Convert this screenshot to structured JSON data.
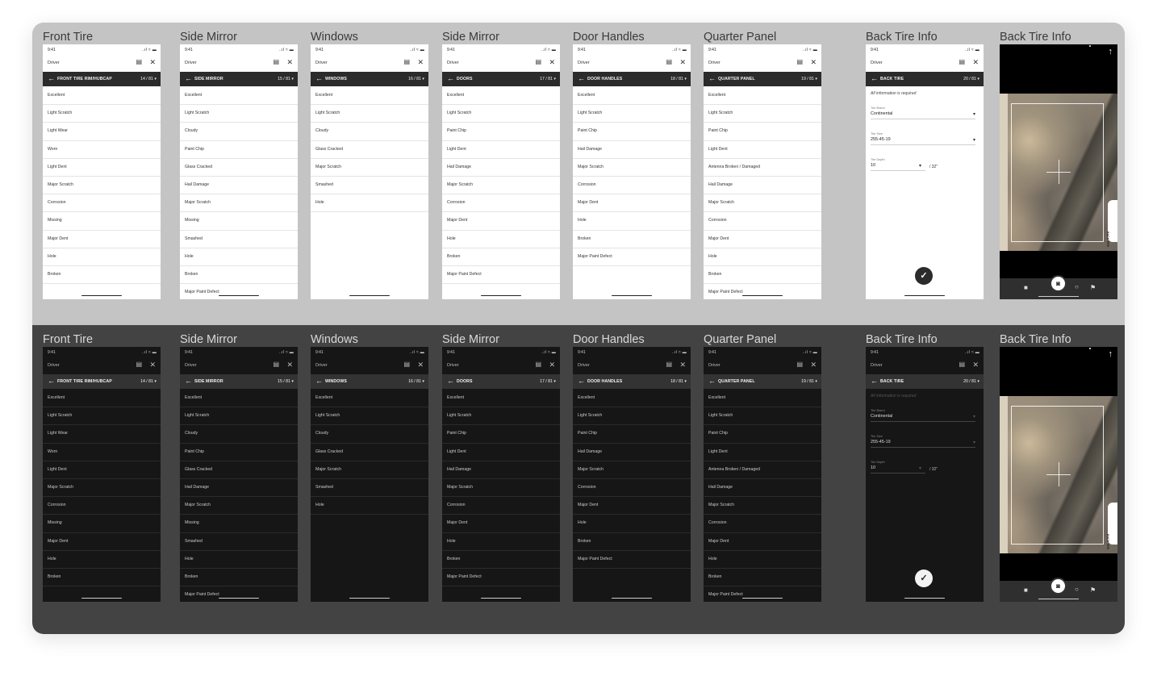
{
  "status": {
    "time": "9:41",
    "signal": "..ıl ≈ ▬"
  },
  "driver_label": "Driver",
  "icons": {
    "doc": "document-icon",
    "close": "close-icon",
    "back": "arrow-left-icon",
    "up": "arrow-up-icon",
    "check": "check-icon"
  },
  "frames": [
    {
      "title": "Front Tire",
      "nav": "FRONT TIRE RIM/HUBCAP",
      "count": "14 / 81",
      "options": [
        "Excellent",
        "Light Scratch",
        "Light Wear",
        "Worn",
        "Light Dent",
        "Major Scratch",
        "Corrosion",
        "Missing",
        "Major Dent",
        "Hole",
        "Broken"
      ]
    },
    {
      "title": "Side Mirror",
      "nav": "SIDE MIRROR",
      "count": "15 / 81",
      "options": [
        "Excellent",
        "Light Scratch",
        "Cloudy",
        "Paint Chip",
        "Glass Cracked",
        "Hail Damage",
        "Major Scratch",
        "Missing",
        "Smashed",
        "Hole",
        "Broken",
        "Major Paint Defect"
      ]
    },
    {
      "title": "Windows",
      "nav": "WINDOWS",
      "count": "16 / 81",
      "options": [
        "Excellent",
        "Light Scratch",
        "Cloudy",
        "Glass Cracked",
        "Major Scratch",
        "Smashed",
        "Hole"
      ]
    },
    {
      "title": "Side Mirror",
      "nav": "DOORS",
      "count": "17 / 81",
      "options": [
        "Excellent",
        "Light Scratch",
        "Paint Chip",
        "Light Dent",
        "Hail Damage",
        "Major Scratch",
        "Corrosion",
        "Major Dent",
        "Hole",
        "Broken",
        "Major Paint Defect"
      ]
    },
    {
      "title": "Door Handles",
      "nav": "DOOR HANDLES",
      "count": "18 / 81",
      "options": [
        "Excellent",
        "Light Scratch",
        "Paint Chip",
        "Hail Damage",
        "Major Scratch",
        "Corrosion",
        "Major Dent",
        "Hole",
        "Broken",
        "Major Paint Defect"
      ]
    },
    {
      "title": "Quarter Panel",
      "nav": "QUARTER PANEL",
      "count": "19 / 81",
      "options": [
        "Excellent",
        "Light Scratch",
        "Paint Chip",
        "Light Dent",
        "Antenna Broken / Damaged",
        "Hail Damage",
        "Major Scratch",
        "Corrosion",
        "Major Dent",
        "Hole",
        "Broken",
        "Major Paint Defect"
      ]
    }
  ],
  "back_tire_info": {
    "title": "Back Tire Info",
    "nav": "BACK TIRE",
    "count": "20 / 81",
    "required_note": "All information is required",
    "brand_label": "Tire Brand",
    "brand_value": "Continental",
    "size_label": "Tire Size",
    "size_value": "255-45-19",
    "depth_label": "Tire Depth",
    "depth_value": "10",
    "depth_unit": "/ 32\""
  },
  "camera": {
    "title": "Back Tire Info",
    "side_tab": "BACK TIRE"
  },
  "colors": {
    "light_band": "#c4c4c4",
    "dark_band": "#434343",
    "nav_bar": "#2b2b2b"
  }
}
